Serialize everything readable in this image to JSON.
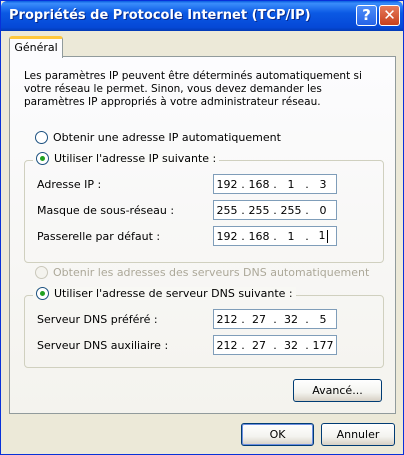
{
  "window": {
    "title": "Propriétés de Protocole Internet (TCP/IP)",
    "help_glyph": "?",
    "close_glyph": "✕"
  },
  "tabs": [
    {
      "label": "Général"
    }
  ],
  "intro_text": "Les paramètres IP peuvent être déterminés automatiquement si votre réseau le permet. Sinon, vous devez demander les paramètres IP appropriés à votre administrateur réseau.",
  "ip_mode": {
    "auto_label": "Obtenir une adresse IP automatiquement",
    "manual_label": "Utiliser l'adresse IP suivante :",
    "selected": "manual"
  },
  "ip_fields": [
    {
      "label": "Adresse IP :",
      "octets": [
        "192",
        "168",
        "1",
        "3"
      ]
    },
    {
      "label": "Masque de sous-réseau :",
      "octets": [
        "255",
        "255",
        "255",
        "0"
      ]
    },
    {
      "label": "Passerelle par défaut :",
      "octets": [
        "192",
        "168",
        "1",
        "1"
      ]
    }
  ],
  "dns_mode": {
    "auto_label": "Obtenir les adresses des serveurs DNS automatiquement",
    "manual_label": "Utiliser l'adresse de serveur DNS suivante :",
    "selected": "manual"
  },
  "dns_fields": [
    {
      "label": "Serveur DNS préféré :",
      "octets": [
        "212",
        "27",
        "32",
        "5"
      ]
    },
    {
      "label": "Serveur DNS auxiliaire :",
      "octets": [
        "212",
        "27",
        "32",
        "177"
      ]
    }
  ],
  "buttons": {
    "advanced": "Avancé...",
    "ok": "OK",
    "cancel": "Annuler"
  },
  "colors": {
    "titlebar": "#0b59e4",
    "window_bg": "#ece9d8",
    "radio_check": "#21a121"
  }
}
